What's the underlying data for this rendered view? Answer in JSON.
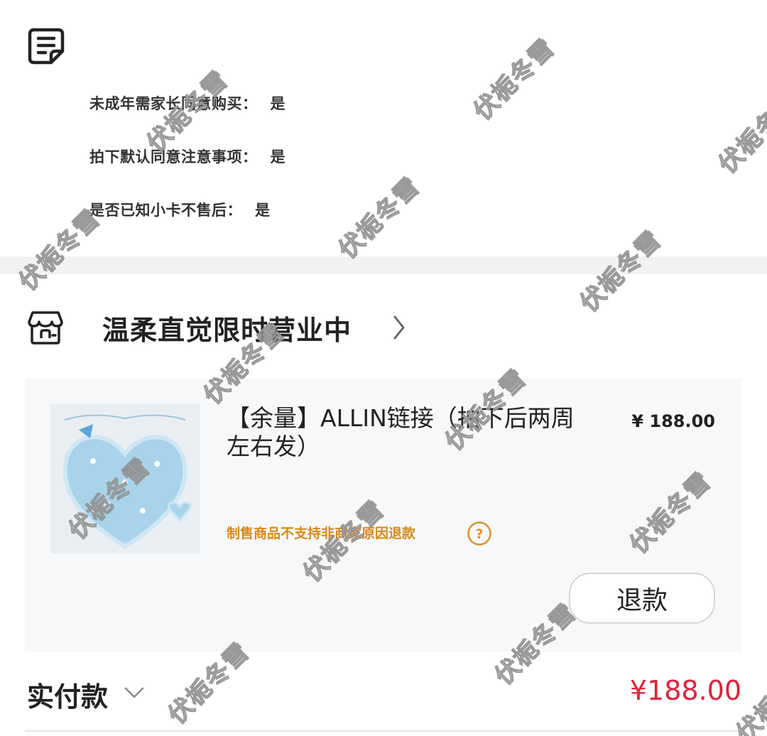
{
  "attributes": [
    {
      "label": "未成年需家长同意购买：",
      "value": "是"
    },
    {
      "label": "拍下默认同意注意事项：",
      "value": "是"
    },
    {
      "label": "是否已知小卡不售后：",
      "value": "是"
    }
  ],
  "shop": {
    "name": "温柔直觉限时营业中"
  },
  "item": {
    "title": "【余量】ALLIN链接（拍下后两周左右发）",
    "price": "¥ 188.00",
    "note": "制售商品不支持非商家原因退款",
    "refund_label": "退款"
  },
  "payment": {
    "label": "实付款",
    "amount": "¥188.00"
  },
  "watermark": {
    "text": "伏栀冬雪"
  },
  "colors": {
    "accent_red": "#e0223a",
    "note_orange": "#d98a1a",
    "card_bg": "#f7f8fa"
  }
}
